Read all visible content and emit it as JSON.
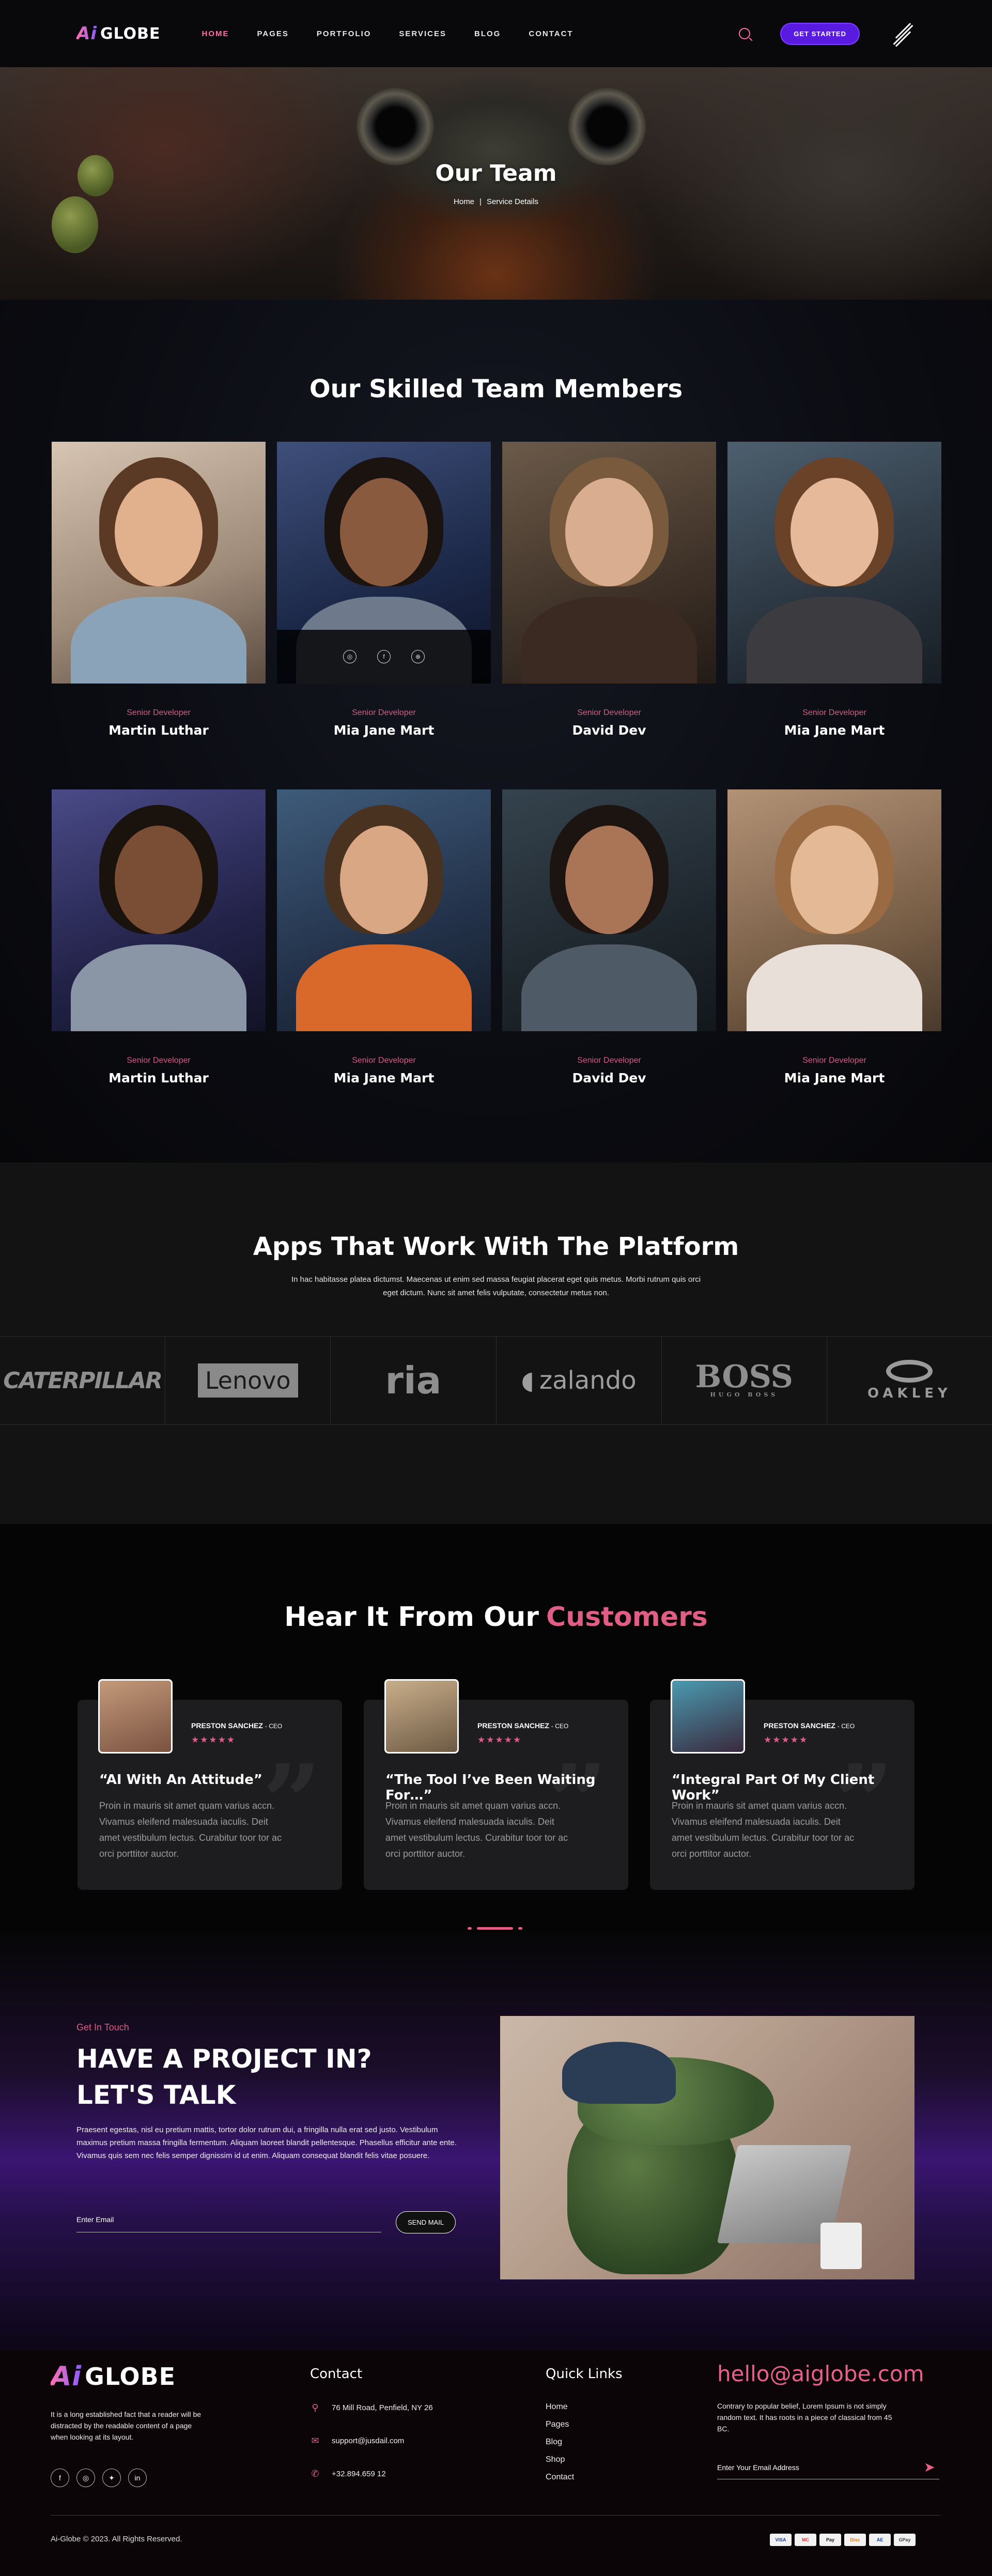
{
  "header": {
    "logo_mark": "Ai",
    "logo_text": "GLOBE",
    "nav": [
      {
        "label": "HOME",
        "active": true
      },
      {
        "label": "PAGES",
        "active": false
      },
      {
        "label": "PORTFOLIO",
        "active": false
      },
      {
        "label": "SERVICES",
        "active": false
      },
      {
        "label": "BLOG",
        "active": false
      },
      {
        "label": "CONTACT",
        "active": false
      }
    ],
    "cta": "GET STARTED",
    "icons": {
      "search": "search-icon",
      "menu": "hamburger-menu-icon"
    },
    "accent": "#ff6fa5",
    "cta_color": "#5a1be0"
  },
  "hero": {
    "title": "Our Team",
    "breadcrumb_home": "Home",
    "breadcrumb_sep": "|",
    "breadcrumb_current": "Service Details"
  },
  "team": {
    "title": "Our Skilled Team Members",
    "members": [
      {
        "role": "Senior Developer",
        "name": "Martin Luthar"
      },
      {
        "role": "Senior Developer",
        "name": "Mia Jane Mart"
      },
      {
        "role": "Senior Developer",
        "name": "David Dev"
      },
      {
        "role": "Senior Developer",
        "name": "Mia Jane Mart"
      },
      {
        "role": "Senior Developer",
        "name": "Martin Luthar"
      },
      {
        "role": "Senior Developer",
        "name": "Mia Jane Mart"
      },
      {
        "role": "Senior Developer",
        "name": "David Dev"
      },
      {
        "role": "Senior Developer",
        "name": "Mia Jane Mart"
      }
    ],
    "social_icons": [
      "instagram-icon",
      "facebook-icon",
      "dribbble-icon"
    ]
  },
  "apps": {
    "title": "Apps That Work With The Platform",
    "description": "In hac habitasse platea dictumst. Maecenas ut enim sed massa feugiat placerat eget quis metus. Morbi rutrum quis orci eget dictum. Nunc sit amet felis vulputate, consectetur metus non.",
    "brands": {
      "caterpillar": "CATERPILLAR",
      "lenovo": "Lenovo",
      "ria": "ria",
      "zalando": "zalando",
      "boss": "BOSS",
      "boss_sub": "HUGO BOSS",
      "oakley": "OAKLEY"
    }
  },
  "testimonials": {
    "title": "Hear It From Our",
    "title_accent": "Customers",
    "items": [
      {
        "name": "PRESTON SANCHEZ",
        "role": "- CEO",
        "stars": "★★★★★",
        "title": "“AI With An Attitude”",
        "text": "Proin in mauris sit amet quam varius accn. Vivamus eleifend malesuada iaculis. Deit amet vestibulum lectus. Curabitur toor tor ac orci porttitor auctor."
      },
      {
        "name": "PRESTON SANCHEZ",
        "role": "- CEO",
        "stars": "★★★★★",
        "title": "“The Tool I’ve Been Waiting For…”",
        "text": "Proin in mauris sit amet quam varius accn. Vivamus eleifend malesuada iaculis. Deit amet vestibulum lectus. Curabitur toor tor ac orci porttitor auctor."
      },
      {
        "name": "PRESTON SANCHEZ",
        "role": "- CEO",
        "stars": "★★★★★",
        "title": "“Integral Part Of My Client Work”",
        "text": "Proin in mauris sit amet quam varius accn. Vivamus eleifend malesuada iaculis. Deit amet vestibulum lectus. Curabitur toor tor ac orci porttitor auctor."
      }
    ]
  },
  "contact": {
    "eyebrow": "Get In Touch",
    "heading_line1": "HAVE A PROJECT IN?",
    "heading_line2": "LET'S TALK",
    "paragraph": "Praesent egestas, nisl eu pretium mattis, tortor dolor rutrum dui, a fringilla nulla erat sed justo. Vestibulum maximus pretium massa fringilla fermentum. Aliquam laoreet blandit pellentesque. Phasellus efficitur ante ente. Vivamus quis sem nec felis semper dignissim id ut enim. Aliquam consequat blandit felis vitae posuere.",
    "email_placeholder": "Enter Email",
    "send_label": "SEND MAIL"
  },
  "footer": {
    "logo_mark": "Ai",
    "logo_text": "GLOBE",
    "description": "It is a long established fact that a reader will be distracted by the readable content of a page when looking at its layout.",
    "contact_title": "Contact",
    "address": "76 Mill Road, Penfield, NY 26",
    "email": "support@jusdail.com",
    "phone": "+32.894.659 12",
    "links_title": "Quick Links",
    "links": [
      "Home",
      "Pages",
      "Blog",
      "Shop",
      "Contact"
    ],
    "big_email": "hello@aiglobe.com",
    "big_email_desc": "Contrary to popular belief, Lorem Ipsum is not simply random text. It has roots in a piece of classical from 45 BC.",
    "subscribe_placeholder": "Enter Your Email Address",
    "copyright": "Ai-Globe © 2023. All Rights Reserved.",
    "payments": [
      "VISA",
      "MC",
      "Pay",
      "Disc",
      "AE",
      "GPay"
    ],
    "social_icons": [
      "facebook-icon",
      "instagram-icon",
      "twitter-icon",
      "linkedin-icon"
    ]
  }
}
